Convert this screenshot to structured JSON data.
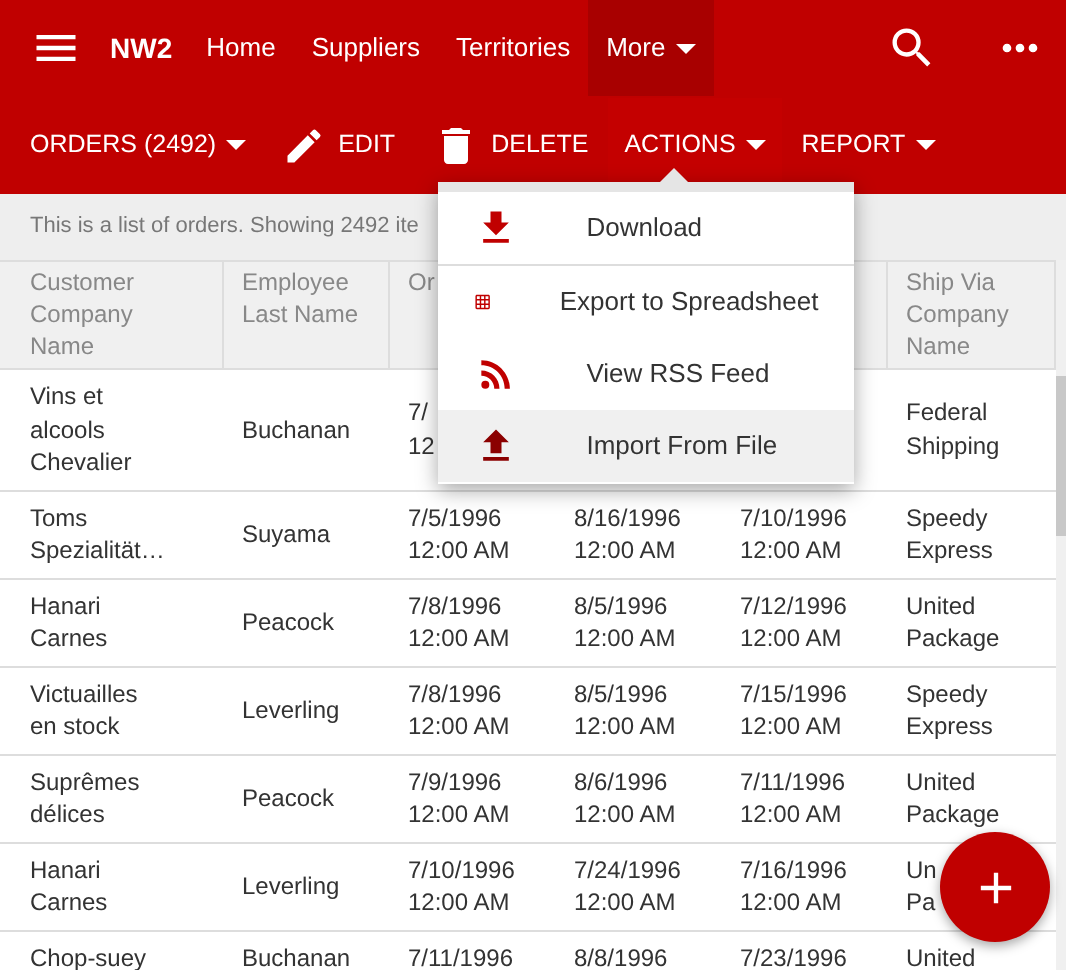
{
  "nav": {
    "brand": "NW2",
    "links": [
      {
        "label": "Home",
        "selected": false,
        "menu": false
      },
      {
        "label": "Suppliers",
        "selected": false,
        "menu": false
      },
      {
        "label": "Territories",
        "selected": false,
        "menu": false
      },
      {
        "label": "More",
        "selected": true,
        "menu": true
      }
    ]
  },
  "toolbar": [
    {
      "label": "ORDERS (2492)",
      "kind": "dropdown",
      "expanded": false
    },
    {
      "label": "EDIT",
      "kind": "edit",
      "expanded": false
    },
    {
      "label": "DELETE",
      "kind": "delete",
      "expanded": false
    },
    {
      "label": "ACTIONS",
      "kind": "dropdown",
      "expanded": true
    },
    {
      "label": "REPORT",
      "kind": "dropdown",
      "expanded": false
    }
  ],
  "actions_menu": [
    {
      "label": "Download",
      "kind": "download",
      "selected": false
    },
    {
      "label": "Export to Spreadsheet",
      "kind": "spreadsheet",
      "selected": false
    },
    {
      "label": "View RSS Feed",
      "kind": "rss",
      "selected": false
    },
    {
      "label": "Import From File",
      "kind": "import",
      "selected": true
    }
  ],
  "info": "This is a list of orders. Showing 2492 ite",
  "table": {
    "columns": [
      [
        "Customer",
        "Company",
        "Name"
      ],
      [
        "Employee",
        "Last Name"
      ],
      [
        "Or"
      ],
      null,
      null,
      [
        "Ship Via",
        "Company",
        "Name"
      ]
    ],
    "rows": [
      [
        [
          "Vins et",
          "alcools",
          "Chevalier"
        ],
        [
          "Buchanan"
        ],
        [
          "7/",
          "12"
        ],
        null,
        null,
        [
          "Federal",
          "Shipping"
        ]
      ],
      [
        [
          "Toms",
          "Spezialität…"
        ],
        [
          "Suyama"
        ],
        [
          "7/5/1996",
          "12:00 AM"
        ],
        [
          "8/16/1996",
          "12:00 AM"
        ],
        [
          "7/10/1996",
          "12:00 AM"
        ],
        [
          "Speedy",
          "Express"
        ]
      ],
      [
        [
          "Hanari",
          "Carnes"
        ],
        [
          "Peacock"
        ],
        [
          "7/8/1996",
          "12:00 AM"
        ],
        [
          "8/5/1996",
          "12:00 AM"
        ],
        [
          "7/12/1996",
          "12:00 AM"
        ],
        [
          "United",
          "Package"
        ]
      ],
      [
        [
          "Victuailles",
          "en stock"
        ],
        [
          "Leverling"
        ],
        [
          "7/8/1996",
          "12:00 AM"
        ],
        [
          "8/5/1996",
          "12:00 AM"
        ],
        [
          "7/15/1996",
          "12:00 AM"
        ],
        [
          "Speedy",
          "Express"
        ]
      ],
      [
        [
          "Suprêmes",
          "délices"
        ],
        [
          "Peacock"
        ],
        [
          "7/9/1996",
          "12:00 AM"
        ],
        [
          "8/6/1996",
          "12:00 AM"
        ],
        [
          "7/11/1996",
          "12:00 AM"
        ],
        [
          "United",
          "Package"
        ]
      ],
      [
        [
          "Hanari",
          "Carnes"
        ],
        [
          "Leverling"
        ],
        [
          "7/10/1996",
          "12:00 AM"
        ],
        [
          "7/24/1996",
          "12:00 AM"
        ],
        [
          "7/16/1996",
          "12:00 AM"
        ],
        [
          "Un",
          "Pa"
        ]
      ],
      [
        [
          "Chop-suey"
        ],
        [
          "Buchanan"
        ],
        [
          "7/11/1996"
        ],
        [
          "8/8/1996"
        ],
        [
          "7/23/1996"
        ],
        [
          "United"
        ]
      ]
    ]
  }
}
